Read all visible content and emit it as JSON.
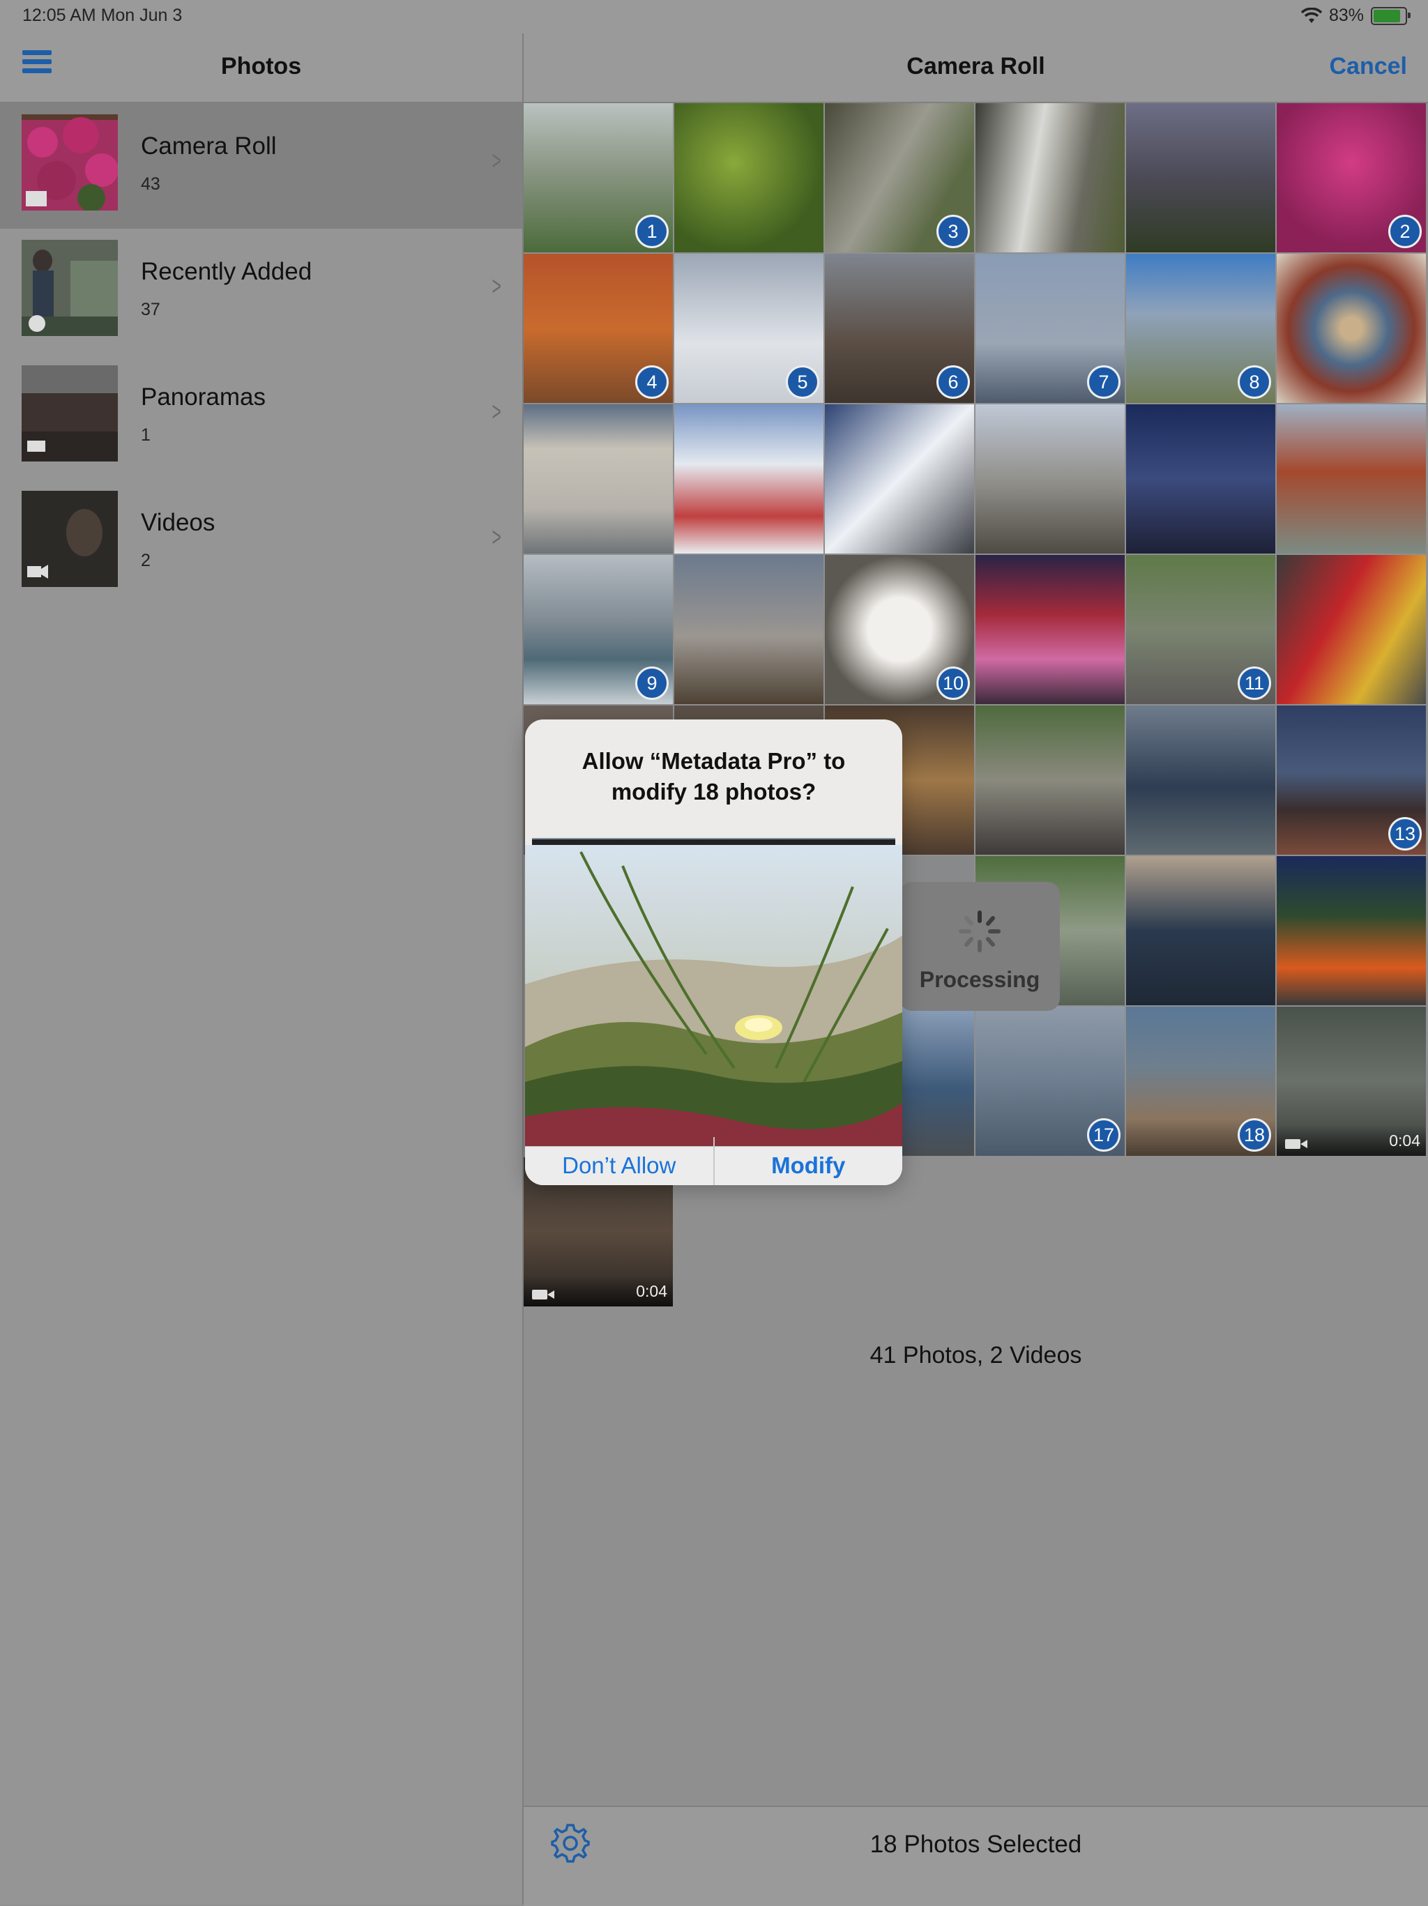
{
  "status_bar": {
    "time": "12:05 AM   Mon Jun 3",
    "battery": "83%",
    "battery_level": 0.83
  },
  "sidebar": {
    "title": "Photos",
    "albums": [
      {
        "name": "Camera Roll",
        "count": "43",
        "icon": "stack-icon"
      },
      {
        "name": "Recently Added",
        "count": "37",
        "icon": "clock-icon"
      },
      {
        "name": "Panoramas",
        "count": "1",
        "icon": "panorama-icon"
      },
      {
        "name": "Videos",
        "count": "2",
        "icon": "video-icon"
      }
    ]
  },
  "header": {
    "title": "Camera Roll",
    "cancel_label": "Cancel"
  },
  "grid": {
    "badges": [
      "1",
      "3",
      "2",
      "4",
      "5",
      "6",
      "7",
      "8",
      "9",
      "10",
      "11",
      "13",
      "17",
      "18"
    ],
    "video_durations": [
      "0:04",
      "0:04"
    ]
  },
  "summary": "41 Photos, 2 Videos",
  "toolbar": {
    "status": "18 Photos Selected"
  },
  "processing": {
    "label": "Processing"
  },
  "alert": {
    "title": "Allow “Metadata Pro” to modify 18 photos?",
    "dont_allow_label": "Don’t Allow",
    "modify_label": "Modify"
  },
  "colors": {
    "accent": "#1d5ea8",
    "alert_button": "#1a73d9",
    "badge": "#1b59a6"
  }
}
